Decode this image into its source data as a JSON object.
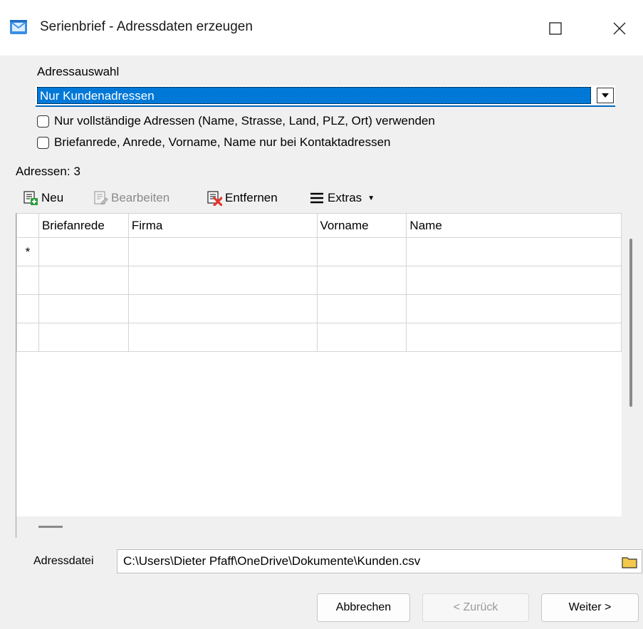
{
  "window": {
    "title": "Serienbrief - Adressdaten erzeugen",
    "maximize_glyph": "☐",
    "close_glyph": "✕"
  },
  "adressauswahl": {
    "label": "Adressauswahl",
    "selected": "Nur Kundenadressen"
  },
  "options": {
    "complete_only": {
      "label": "Nur vollständige Adressen (Name, Strasse, Land, PLZ, Ort) verwenden",
      "checked": false
    },
    "contact_only": {
      "label": "Briefanrede, Anrede, Vorname, Name nur bei Kontaktadressen",
      "checked": false
    }
  },
  "addresses": {
    "label": "Adressen:",
    "count": "3"
  },
  "toolbar": {
    "new_label": "Neu",
    "edit_label": "Bearbeiten",
    "remove_label": "Entfernen",
    "extras_label": "Extras"
  },
  "grid": {
    "columns": [
      "Briefanrede",
      "Firma",
      "Vorname",
      "Name"
    ],
    "new_row_marker": "*",
    "rows": [
      [
        "",
        "",
        "",
        ""
      ],
      [
        "",
        "",
        "",
        ""
      ],
      [
        "",
        "",
        "",
        ""
      ],
      [
        "",
        "",
        "",
        ""
      ]
    ]
  },
  "file": {
    "label": "Adressdatei",
    "value": "C:\\Users\\Dieter Pfaff\\OneDrive\\Dokumente\\Kunden.csv"
  },
  "buttons": {
    "cancel": "Abbrechen",
    "back": "< Zurück",
    "next": "Weiter >"
  },
  "colors": {
    "accent": "#0078d7",
    "remove_icon": "#e5342b",
    "add_icon": "#2e9e3e",
    "folder_icon": "#f2c94c"
  }
}
